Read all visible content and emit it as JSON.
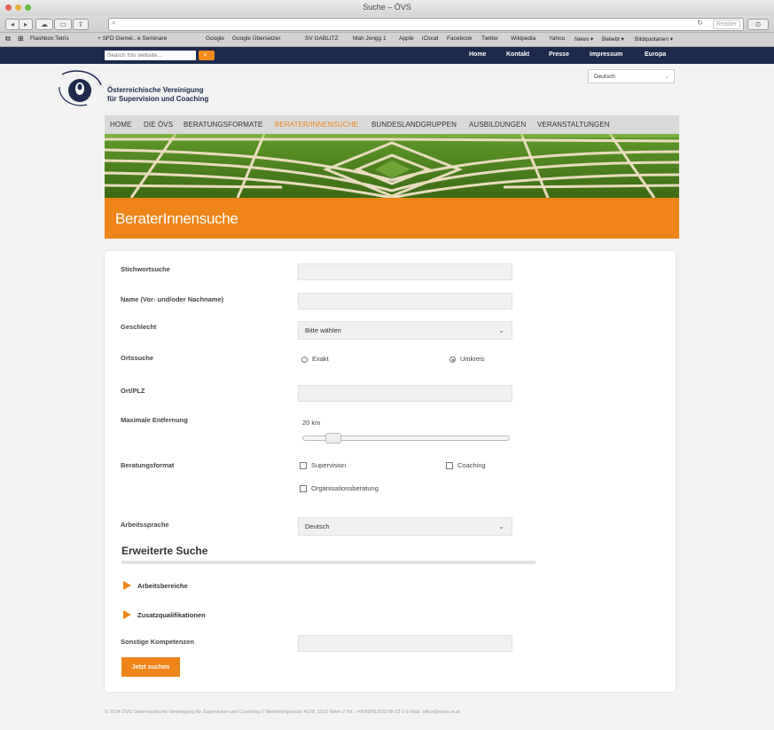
{
  "window": {
    "title": "Suche – ÖVS"
  },
  "browser": {
    "reader_label": "Reader",
    "bookmarks": [
      "Flashbox Tetris",
      "+ SFD Gemei.. e Seminare",
      "Google",
      "Google Übersetzer",
      "SV GABLITZ",
      "Mah Jongg 1",
      "Apple",
      "iCloud",
      "Facebook",
      "Twitter",
      "Wikipedia",
      "Yahoo",
      "News ▾",
      "Beliebt ▾",
      "Bildquotanen ▾"
    ]
  },
  "sitebar": {
    "search_placeholder": "Search this website...",
    "links": [
      "Home",
      "Kontakt",
      "Presse",
      "Impressum",
      "Europa"
    ]
  },
  "logo": {
    "line1": "Österreichische Vereinigung",
    "line2": "für Supervision und Coaching"
  },
  "language_select": {
    "value": "Deutsch"
  },
  "nav": [
    "HOME",
    "DIE ÖVS",
    "BERATUNGSFORMATE",
    "BERATER/INNENSUCHE",
    "BUNDESLANDGRUPPEN",
    "AUSBILDUNGEN",
    "VERANSTALTUNGEN"
  ],
  "colors": {
    "accent": "#ee8418",
    "navy": "#1d2a4c",
    "nav_active": "#ee8418"
  },
  "page_heading": "BeraterInnensuche",
  "form": {
    "stichwort_label": "Stichwortsuche",
    "name_label": "Name (Vor- und/oder Nachname)",
    "geschlecht_label": "Geschlecht",
    "geschlecht_value": "Bitte wählen",
    "ortssuche_label": "Ortssuche",
    "ortssuche_opt1": "Exakt",
    "ortssuche_opt2": "Umkreis",
    "ortplz_label": "Ort/PLZ",
    "entfernung_label": "Maximale Entfernung",
    "entfernung_value": "20 km",
    "entfernung_fraction": 0.12,
    "beratungsformat_label": "Beratungsformat",
    "format_opt1": "Supervision",
    "format_opt2": "Coaching",
    "format_opt3": "Organisationsberatung",
    "arbeitssprache_label": "Arbeitssprache",
    "arbeitssprache_value": "Deutsch",
    "erweitert_heading": "Erweiterte Suche",
    "arbeitsbereiche_label": "Arbeitsbereiche",
    "zusatz_label": "Zusatzqualifikationen",
    "kompetenzen_label": "Sonstige Kompetenzen",
    "submit_label": "Jetzt suchen"
  },
  "footer": "© 2014 ÖVS Österreichische Vereinigung für Supervision und Coaching // Weihnbürgstraße 4/2/8, 1010 Wien // Tel.: +0043/01/533-08-22 // E-Mail: office@oevs.or.at"
}
